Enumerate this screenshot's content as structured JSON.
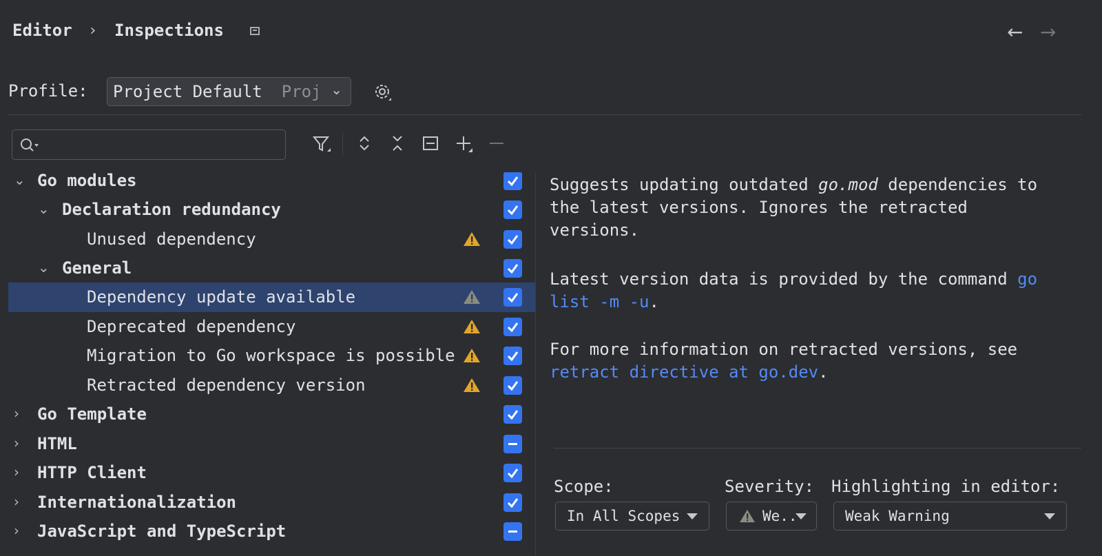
{
  "breadcrumb": {
    "parent": "Editor",
    "separator": "›",
    "current": "Inspections"
  },
  "nav": {
    "back": "←",
    "forward": "→"
  },
  "profile": {
    "label": "Profile:",
    "value": "Project Default",
    "suffix": "Project"
  },
  "search": {
    "placeholder": ""
  },
  "tree": [
    {
      "label": "Go modules",
      "expanded": true,
      "checked": "checked"
    },
    {
      "label": "Declaration redundancy",
      "expanded": true,
      "checked": "checked"
    },
    {
      "label": "Unused dependency",
      "warning": true,
      "checked": "checked"
    },
    {
      "label": "General",
      "expanded": true,
      "checked": "checked"
    },
    {
      "label": "Dependency update available",
      "warning": true,
      "selected": true,
      "checked": "checked"
    },
    {
      "label": "Deprecated dependency",
      "warning": true,
      "checked": "checked"
    },
    {
      "label": "Migration to Go workspace is possible",
      "warning": true,
      "checked": "checked"
    },
    {
      "label": "Retracted dependency version",
      "warning": true,
      "checked": "checked"
    },
    {
      "label": "Go Template",
      "expanded": false,
      "checked": "checked"
    },
    {
      "label": "HTML",
      "expanded": false,
      "checked": "partial"
    },
    {
      "label": "HTTP Client",
      "expanded": false,
      "checked": "checked"
    },
    {
      "label": "Internationalization",
      "expanded": false,
      "checked": "checked"
    },
    {
      "label": "JavaScript and TypeScript",
      "expanded": false,
      "checked": "partial"
    }
  ],
  "description": {
    "p1_a": "Suggests updating outdated ",
    "p1_code": "go.mod",
    "p1_b1": " dependencies to",
    "p1_b2": "the latest versions. Ignores the retracted",
    "p1_b3": "versions.",
    "p2_a": "Latest version data is provided by the command ",
    "p2_link1": "go",
    "p2_link2": "list -m -u",
    "p2_end": ".",
    "p3_a": "For more information on retracted versions, see",
    "p3_link": "retract directive at go.dev",
    "p3_end": "."
  },
  "settings": {
    "scope_label": "Scope:",
    "scope_value": "In All Scopes",
    "severity_label": "Severity:",
    "severity_value": "We..",
    "highlight_label": "Highlighting in editor:",
    "highlight_value": "Weak Warning"
  },
  "colors": {
    "accent": "#3574f0",
    "link": "#548af7",
    "warning": "#e0a52b",
    "selection": "#2e436e"
  }
}
